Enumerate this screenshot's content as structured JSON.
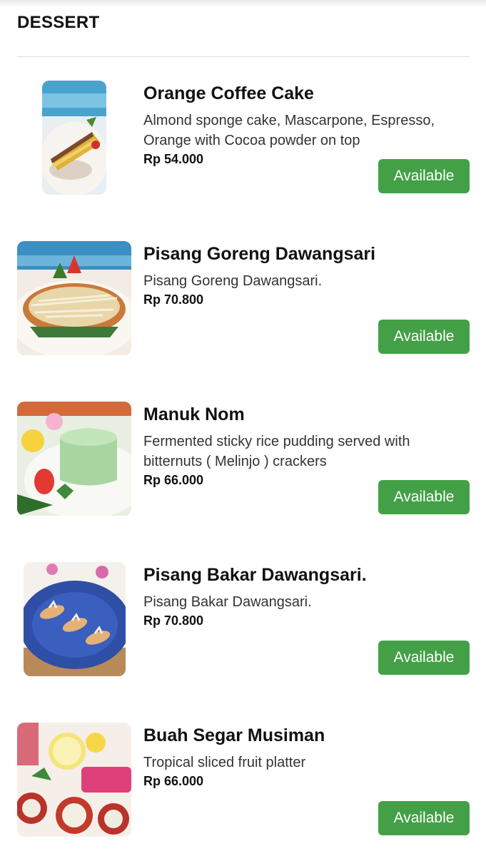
{
  "section": {
    "title": "DESSERT"
  },
  "items": [
    {
      "name": "Orange Coffee Cake",
      "description": "Almond sponge cake, Mascarpone, Espresso, Orange with Cocoa powder on top",
      "price": "Rp 54.000",
      "status": "Available",
      "image_icon": "orange-coffee-cake-photo"
    },
    {
      "name": "Pisang Goreng Dawangsari",
      "description": "Pisang Goreng Dawangsari.",
      "price": "Rp 70.800",
      "status": "Available",
      "image_icon": "pisang-goreng-photo"
    },
    {
      "name": "Manuk Nom",
      "description": "Fermented sticky rice pudding served with bitternuts ( Melinjo ) crackers",
      "price": "Rp 66.000",
      "status": "Available",
      "image_icon": "manuk-nom-photo"
    },
    {
      "name": "Pisang Bakar Dawangsari.",
      "description": "Pisang Bakar Dawangsari.",
      "price": "Rp 70.800",
      "status": "Available",
      "image_icon": "pisang-bakar-photo"
    },
    {
      "name": "Buah Segar Musiman",
      "description": "Tropical sliced fruit platter",
      "price": "Rp 66.000",
      "status": "Available",
      "image_icon": "fruit-platter-photo"
    }
  ],
  "colors": {
    "available_button": "#43a047",
    "divider": "#dcdcdc"
  }
}
